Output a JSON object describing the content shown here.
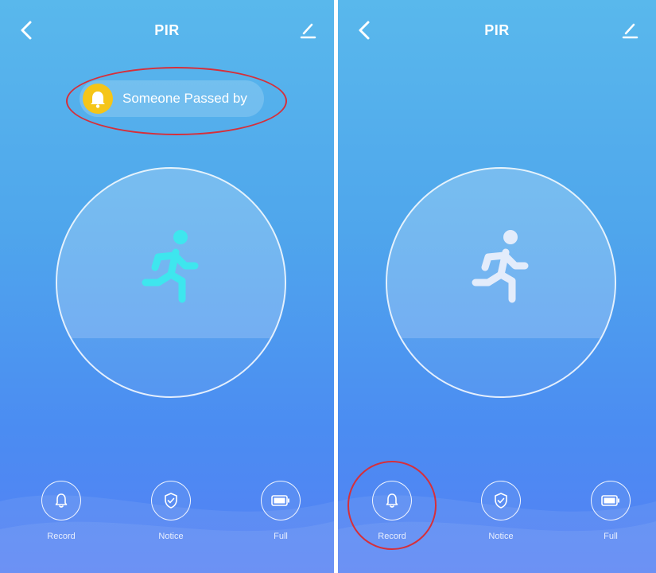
{
  "screens": [
    {
      "header": {
        "title": "PIR",
        "back_icon": "chevron-left-icon",
        "edit_icon": "pencil-icon"
      },
      "notification": {
        "text": "Someone Passed by",
        "icon": "bell-icon",
        "icon_color": "#f5c518"
      },
      "sensor": {
        "state": "motion-detected",
        "figure_icon": "running-person-icon",
        "figure_color": "#3ee6ee"
      },
      "controls": [
        {
          "label": "Record",
          "icon": "bell-icon"
        },
        {
          "label": "Notice",
          "icon": "shield-check-icon"
        },
        {
          "label": "Full",
          "icon": "battery-icon"
        }
      ]
    },
    {
      "header": {
        "title": "PIR",
        "back_icon": "chevron-left-icon",
        "edit_icon": "pencil-icon"
      },
      "sensor": {
        "state": "idle",
        "figure_icon": "running-person-icon",
        "figure_color": "#e3ecfb"
      },
      "controls": [
        {
          "label": "Record",
          "icon": "bell-icon"
        },
        {
          "label": "Notice",
          "icon": "shield-check-icon"
        },
        {
          "label": "Full",
          "icon": "battery-icon"
        }
      ]
    }
  ],
  "annotations": {
    "color": "#d62f3a",
    "highlighted": [
      "notification",
      "record-button"
    ]
  }
}
